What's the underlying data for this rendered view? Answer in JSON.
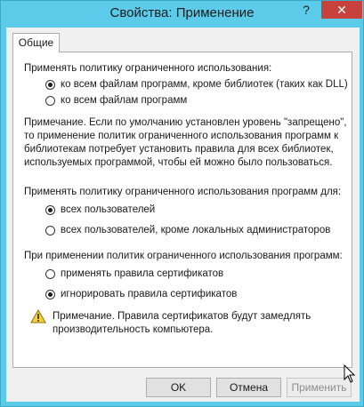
{
  "window": {
    "title": "Свойства: Применение",
    "help_glyph": "?",
    "close_glyph": "✕"
  },
  "tabs": [
    {
      "label": "Общие",
      "selected": true
    }
  ],
  "section1": {
    "heading": "Применять политику ограниченного использования:",
    "options": [
      {
        "label": "ко всем файлам программ, кроме библиотек (таких как DLL)",
        "checked": true
      },
      {
        "label": "ко всем файлам программ",
        "checked": false
      }
    ]
  },
  "note1": {
    "lines": [
      "Примечание. Если по умолчанию установлен уровень \"запрещено\",",
      "то применение политик ограниченного использования программ к",
      "библиотекам потребует установить правила для всех библиотек,",
      "используемых  программой, чтобы ей можно было пользоваться."
    ]
  },
  "section2": {
    "heading": "Применять политику ограниченного использования программ для:",
    "options": [
      {
        "label": "всех пользователей",
        "checked": true
      },
      {
        "label": "всех пользователей, кроме локальных администраторов",
        "checked": false
      }
    ]
  },
  "section3": {
    "heading": "При применении политик ограниченного использования программ:",
    "options": [
      {
        "label": "применять правила сертификатов",
        "checked": false
      },
      {
        "label": "игнорировать правила сертификатов",
        "checked": true
      }
    ]
  },
  "warning": {
    "icon": "warning-icon",
    "lines": [
      "Примечание. Правила сертификатов будут замедлять",
      "производительность компьютера."
    ]
  },
  "buttons": {
    "ok": "OK",
    "cancel": "Отмена",
    "apply": "Применить"
  },
  "colors": {
    "titlebar": "#5ccbe9",
    "close": "#c7423d",
    "panel": "#ffffff"
  }
}
